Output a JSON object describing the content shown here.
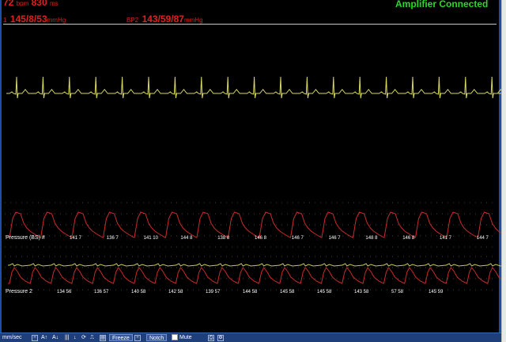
{
  "header": {
    "hr_value": "72",
    "hr_unit": "bpm",
    "rr_value": "830",
    "rr_unit": "ms",
    "bp1_prefix": "1",
    "bp1_value": "145/8/53",
    "bp1_unit": "mmHg",
    "bp2_label": "BP2",
    "bp2_value": "143/59/87",
    "bp2_unit": "mmHg",
    "amplifier_status": "Amplifier Connected"
  },
  "colors": {
    "ecg_trace": "#d8d862",
    "pressure_trace": "#cc2a2a",
    "pressure_overlay": "#c8c850",
    "header_text": "#e02020",
    "status_text": "#22dd22",
    "toolbar_bg": "#1f3f7a"
  },
  "channels": {
    "pressure1_label": "Pressure (BS) #",
    "pressure2_label": "Pressure 2",
    "pressure1_beats": [
      "141 7",
      "136 7",
      "141 10",
      "144 8",
      "138 8",
      "146 8",
      "146 7",
      "146 7",
      "148 8",
      "146 8",
      "141 7",
      "144 7"
    ],
    "pressure2_beats": [
      "134 56",
      "136 57",
      "140 58",
      "142 58",
      "139 57",
      "144 58",
      "145 58",
      "145 58",
      "143 58",
      "57 58",
      "145 59"
    ]
  },
  "toolbar": {
    "speed_label": "mm/sec",
    "freeze_label": "Freeze",
    "notch_label": "Notch",
    "mute_label": "Mute"
  }
}
